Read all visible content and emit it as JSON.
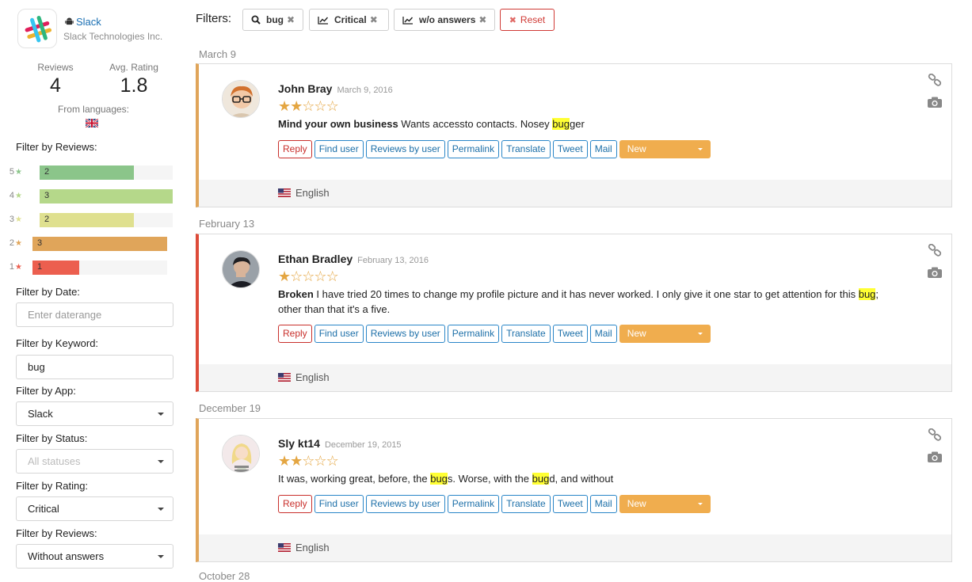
{
  "app": {
    "name": "Slack",
    "company": "Slack Technologies Inc."
  },
  "stats": {
    "reviews_label": "Reviews",
    "reviews_value": "4",
    "rating_label": "Avg. Rating",
    "rating_value": "1.8",
    "languages_label": "From languages:"
  },
  "sidebar": {
    "filter_reviews_label": "Filter by Reviews:",
    "rating_bars": [
      {
        "stars": "5",
        "count": "2",
        "fraction": 0.71,
        "color": "#8bc58a"
      },
      {
        "stars": "4",
        "count": "3",
        "fraction": 1.0,
        "color": "#b5d88a"
      },
      {
        "stars": "3",
        "count": "2",
        "fraction": 0.71,
        "color": "#dfe08f"
      },
      {
        "stars": "2",
        "count": "3",
        "fraction": 1.0,
        "color": "#e0a55a"
      },
      {
        "stars": "1",
        "count": "1",
        "fraction": 0.35,
        "color": "#ec5f4f"
      }
    ],
    "filter_date_label": "Filter by Date:",
    "date_placeholder": "Enter daterange",
    "filter_keyword_label": "Filter by Keyword:",
    "keyword_value": "bug",
    "filter_app_label": "Filter by App:",
    "app_value": "Slack",
    "filter_status_label": "Filter by Status:",
    "status_value": "All statuses",
    "filter_rating_label": "Filter by Rating:",
    "rating_value": "Critical",
    "filter_answers_label": "Filter by Reviews:",
    "answers_value": "Without answers"
  },
  "filterbar": {
    "label": "Filters:",
    "chips": [
      {
        "label": "bug",
        "icon": "search-icon"
      },
      {
        "label": "Critical",
        "icon": "chart-line-icon"
      },
      {
        "label": "w/o answers",
        "icon": "chart-line-icon"
      }
    ],
    "reset_label": "Reset"
  },
  "actions": {
    "reply": "Reply",
    "find_user": "Find user",
    "reviews_by_user": "Reviews by user",
    "permalink": "Permalink",
    "translate": "Translate",
    "tweet": "Tweet",
    "mail": "Mail",
    "status": "New"
  },
  "reviews": [
    {
      "group_date": "March 9",
      "author": "John Bray",
      "date": "March 9, 2016",
      "rating": 2,
      "title": "Mind your own business",
      "segments": [
        " Wants accessto contacts. Nosey ",
        "bug",
        "ger"
      ],
      "language": "English"
    },
    {
      "group_date": "February 13",
      "author": "Ethan Bradley",
      "date": "February 13, 2016",
      "rating": 1,
      "title": "Broken",
      "segments": [
        " I have tried 20 times to change my profile picture and it has never worked. I only give it one star to get attention for this ",
        "bug",
        "; other than that it's a five."
      ],
      "language": "English"
    },
    {
      "group_date": "December 19",
      "author": "Sly kt14",
      "date": "December 19, 2015",
      "rating": 2,
      "title": "",
      "segments": [
        "It was, working great, before, the ",
        "bug",
        "s. Worse, with the ",
        "bug",
        "d, and without"
      ],
      "language": "English"
    }
  ],
  "next_group_date": "October 28"
}
